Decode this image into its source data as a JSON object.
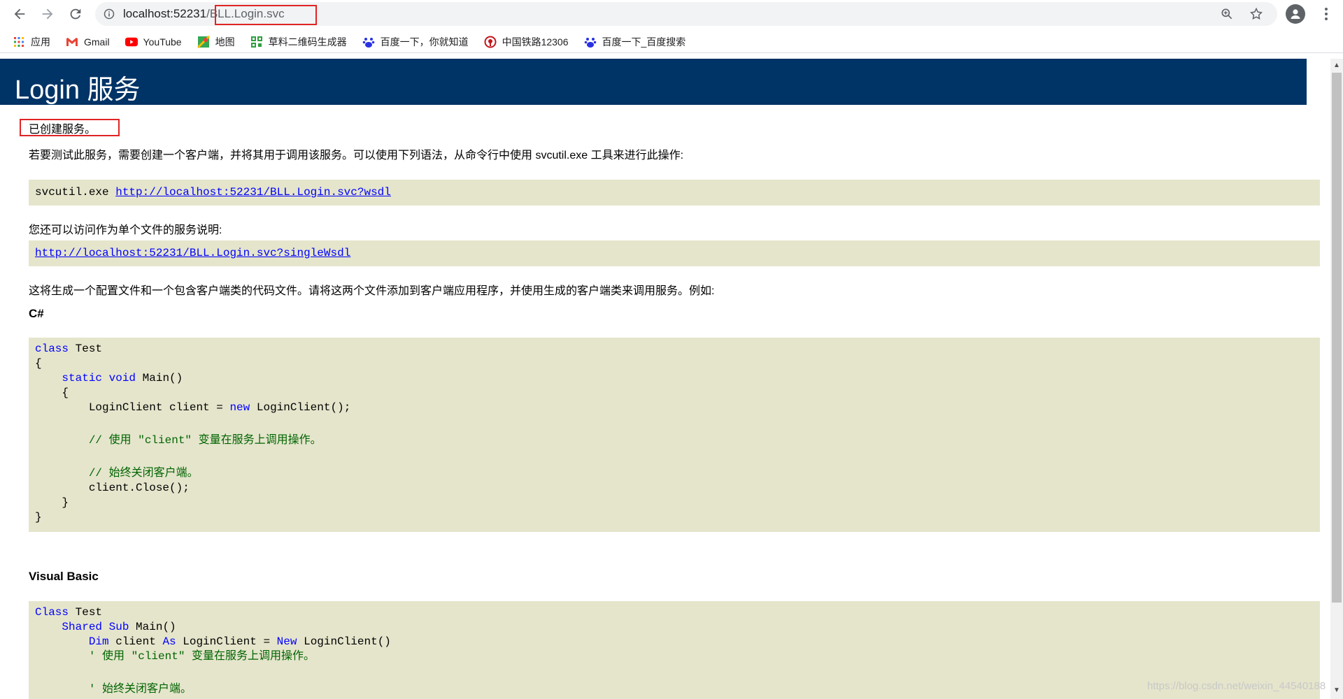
{
  "browser": {
    "url_host": "localhost:52231",
    "url_path": "/BLL.Login.svc",
    "bookmarks": [
      {
        "label": "应用",
        "icon": "apps-grid-icon"
      },
      {
        "label": "Gmail",
        "icon": "gmail-icon"
      },
      {
        "label": "YouTube",
        "icon": "youtube-icon"
      },
      {
        "label": "地图",
        "icon": "maps-icon"
      },
      {
        "label": "草料二维码生成器",
        "icon": "qrcode-icon"
      },
      {
        "label": "百度一下，你就知道",
        "icon": "baidu-paw-icon"
      },
      {
        "label": "中国铁路12306",
        "icon": "railway-icon"
      },
      {
        "label": "百度一下_百度搜索",
        "icon": "baidu-paw-icon"
      }
    ]
  },
  "page": {
    "heading": "Login 服务",
    "created": "已创建服务。",
    "intro": "若要测试此服务，需要创建一个客户端，并将其用于调用该服务。可以使用下列语法，从命令行中使用 svcutil.exe 工具来进行此操作:",
    "svcutil_cmd": "svcutil.exe ",
    "wsdl_link": "http://localhost:52231/BLL.Login.svc?wsdl",
    "single_file_text": "您还可以访问作为单个文件的服务说明:",
    "single_wsdl_link": "http://localhost:52231/BLL.Login.svc?singleWsdl",
    "generate_text": "这将生成一个配置文件和一个包含客户端类的代码文件。请将这两个文件添加到客户端应用程序，并使用生成的客户端类来调用服务。例如:",
    "csharp_title": "C#",
    "vb_title": "Visual Basic",
    "csharp": {
      "l1_kw": "class",
      "l1_rest": " Test",
      "l2": "{",
      "l3_pad": "    ",
      "l3_kw1": "static",
      "l3_sp": " ",
      "l3_kw2": "void",
      "l3_rest": " Main()",
      "l4": "    {",
      "l5_a": "        LoginClient client = ",
      "l5_kw": "new",
      "l5_b": " LoginClient();",
      "l6": "",
      "l7_pad": "        ",
      "l7_cm": "// 使用 \"client\" 变量在服务上调用操作。",
      "l8": "",
      "l9_pad": "        ",
      "l9_cm": "// 始终关闭客户端。",
      "l10": "        client.Close();",
      "l11": "    }",
      "l12": "}"
    },
    "vb": {
      "l1_kw": "Class",
      "l1_rest": " Test",
      "l2_pad": "    ",
      "l2_kw1": "Shared",
      "l2_sp": " ",
      "l2_kw2": "Sub",
      "l2_rest": " Main()",
      "l3_pad": "        ",
      "l3_kw1": "Dim",
      "l3_mid": " client ",
      "l3_kw2": "As",
      "l3_b": " LoginClient = ",
      "l3_kw3": "New",
      "l3_c": " LoginClient()",
      "l4_pad": "        ",
      "l4_cm": "' 使用 \"client\" 变量在服务上调用操作。",
      "l5": "",
      "l6_pad": "        ",
      "l6_cm": "' 始终关闭客户端。"
    }
  },
  "watermark": "https://blog.csdn.net/weixin_44540188"
}
